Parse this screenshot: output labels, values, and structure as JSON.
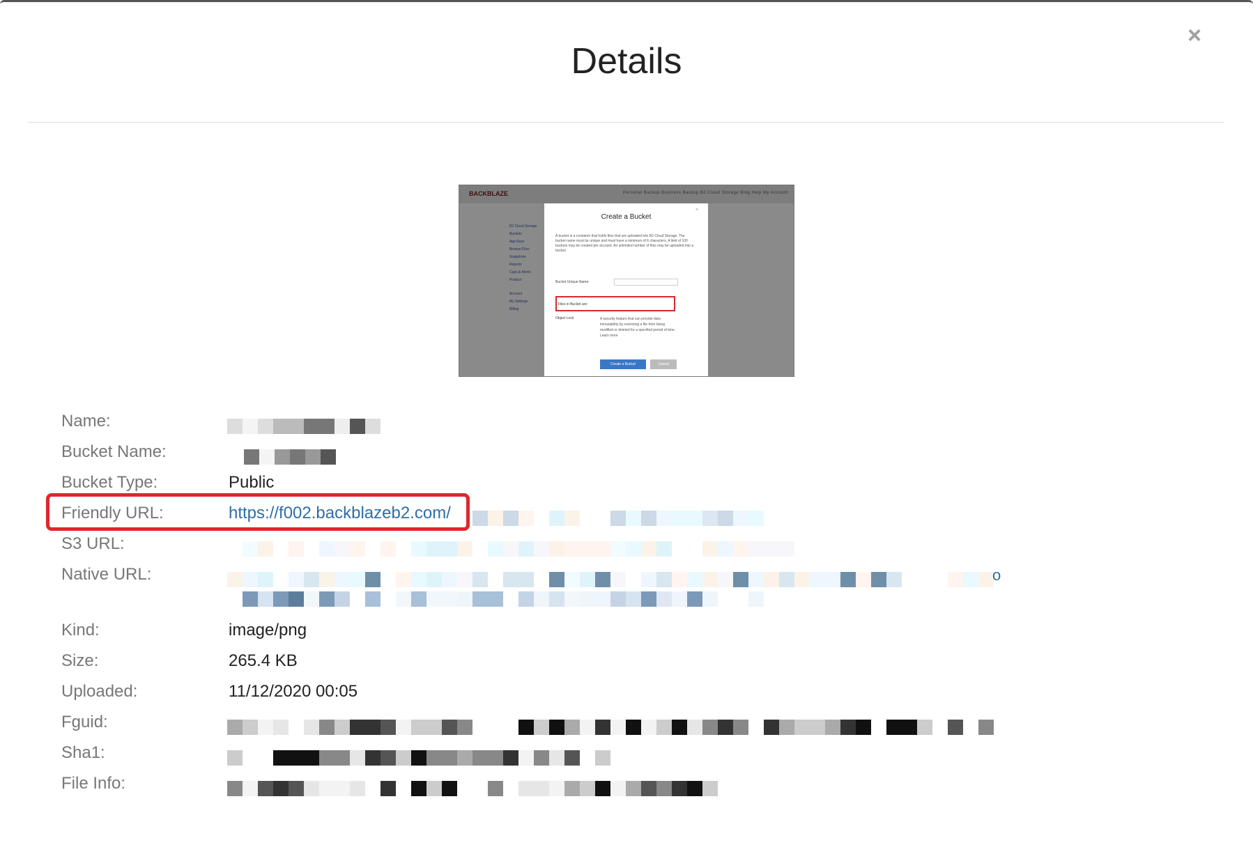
{
  "dialog": {
    "title": "Details",
    "close_label": "×"
  },
  "thumbnail": {
    "logo": "BACKBLAZE",
    "nav": "Personal Backup   Business Backup   B2 Cloud Storage   Blog   Help   My Account",
    "sidebar": [
      "B2 Cloud Storage",
      "Buckets",
      "App Keys",
      "Browse Files",
      "Snapshots",
      "Reports",
      "Caps & Alerts",
      "Product",
      "Account",
      "My Settings",
      "Billing"
    ],
    "modal_title": "Create a Bucket",
    "modal_text": "A bucket is a container that holds files that are uploaded into B2 Cloud Storage. The bucket name must be unique and must have a minimum of 6 characters. A limit of 100 buckets may be created per account. An unlimited number of files may be uploaded into a bucket.",
    "field_label": "Bucket Unique Name:",
    "files_label": "Files in Bucket are:",
    "object_lock_label": "Object Lock",
    "object_lock_desc": "A security feature that can provide data immutability by restricting a file from being modified or deleted for a specified period of time. Learn more",
    "create_button": "Create a Bucket",
    "cancel_button": "Cancel"
  },
  "details": {
    "name_label": "Name:",
    "bucket_name_label": "Bucket Name:",
    "bucket_type_label": "Bucket Type:",
    "bucket_type_value": "Public",
    "friendly_url_label": "Friendly URL:",
    "friendly_url_value": "https://f002.backblazeb2.com/",
    "s3_url_label": "S3 URL:",
    "native_url_label": "Native URL:",
    "native_url_tail": "o",
    "kind_label": "Kind:",
    "kind_value": "image/png",
    "size_label": "Size:",
    "size_value": "265.4 KB",
    "uploaded_label": "Uploaded:",
    "uploaded_value": "11/12/2020 00:05",
    "fguid_label": "Fguid:",
    "sha1_label": "Sha1:",
    "file_info_label": "File Info:"
  },
  "colors": {
    "link": "#2e6ea8",
    "highlight": "#e0262d"
  }
}
